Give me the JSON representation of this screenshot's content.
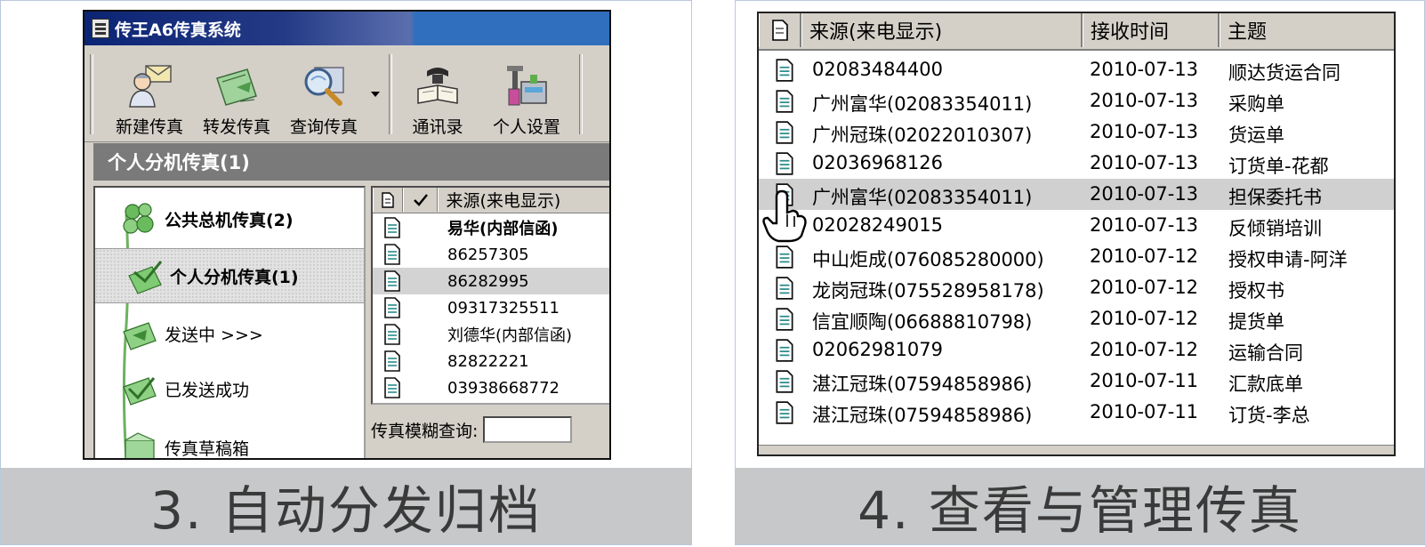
{
  "left_panel": {
    "window_title": "传王A6传真系统",
    "toolbar": [
      {
        "label": "新建传真",
        "icon": "new-fax-icon"
      },
      {
        "label": "转发传真",
        "icon": "forward-fax-icon"
      },
      {
        "label": "查询传真",
        "icon": "search-fax-icon"
      },
      {
        "label": "通讯录",
        "icon": "address-book-icon"
      },
      {
        "label": "个人设置",
        "icon": "personal-settings-icon"
      }
    ],
    "section_title": "个人分机传真(1)",
    "nav_items": [
      {
        "label": "公共总机传真(2)"
      },
      {
        "label": "个人分机传真(1)"
      },
      {
        "label": "发送中 >>>"
      },
      {
        "label": "已发送成功"
      },
      {
        "label": "传真草稿箱"
      }
    ],
    "list": {
      "header_source": "来源(来电显示)",
      "rows": [
        {
          "source": "易华(内部信函)"
        },
        {
          "source": "86257305"
        },
        {
          "source": "86282995"
        },
        {
          "source": "09317325511"
        },
        {
          "source": "刘德华(内部信函)"
        },
        {
          "source": "82822221"
        },
        {
          "source": "03938668772"
        }
      ]
    },
    "search_label": "传真模糊查询:",
    "caption": "3. 自动分发归档"
  },
  "right_panel": {
    "headers": {
      "source": "来源(来电显示)",
      "time": "接收时间",
      "subject": "主题"
    },
    "rows": [
      {
        "source": "02083484400",
        "time": "2010-07-13",
        "subject": "顺达货运合同"
      },
      {
        "source": "广州富华(02083354011)",
        "time": "2010-07-13",
        "subject": "采购单"
      },
      {
        "source": "广州冠珠(02022010307)",
        "time": "2010-07-13",
        "subject": "货运单"
      },
      {
        "source": "02036968126",
        "time": "2010-07-13",
        "subject": "订货单-花都"
      },
      {
        "source": "广州富华(02083354011)",
        "time": "2010-07-13",
        "subject": "担保委托书"
      },
      {
        "source": "02028249015",
        "time": "2010-07-13",
        "subject": "反倾销培训"
      },
      {
        "source": "中山炬成(076085280000)",
        "time": "2010-07-12",
        "subject": "授权申请-阿洋"
      },
      {
        "source": "龙岗冠珠(075528958178)",
        "time": "2010-07-12",
        "subject": "授权书"
      },
      {
        "source": "信宜顺陶(06688810798)",
        "time": "2010-07-12",
        "subject": "提货单"
      },
      {
        "source": "02062981079",
        "time": "2010-07-12",
        "subject": "运输合同"
      },
      {
        "source": "湛江冠珠(07594858986)",
        "time": "2010-07-11",
        "subject": "汇款底单"
      },
      {
        "source": "湛江冠珠(07594858986)",
        "time": "2010-07-11",
        "subject": "订货-李总"
      }
    ],
    "caption": "4. 查看与管理传真"
  }
}
